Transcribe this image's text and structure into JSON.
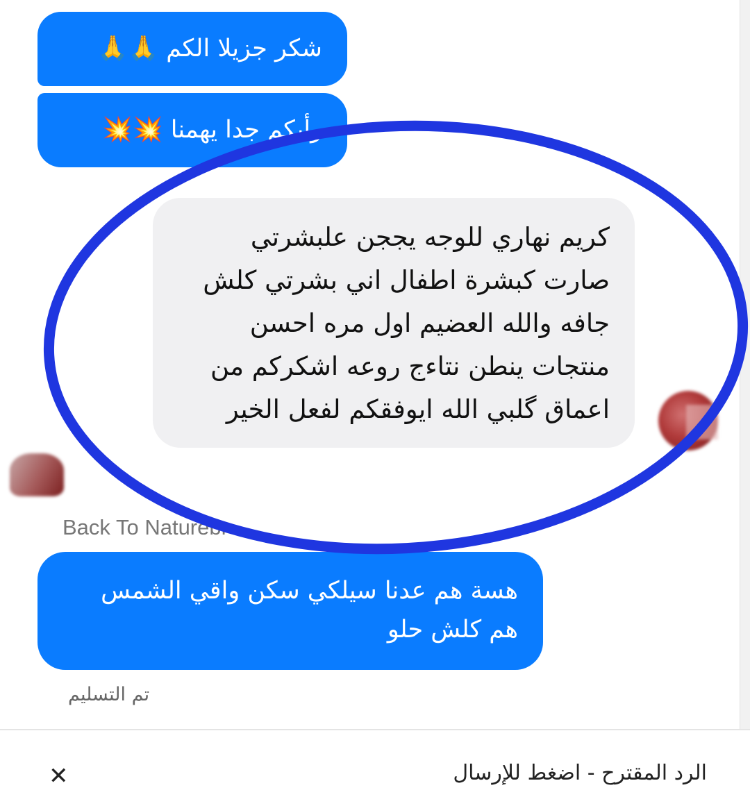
{
  "conversation": {
    "messages": [
      {
        "text": "شكر جزيلا الكم 🙏🙏"
      },
      {
        "text": "رأيكم جدا يهمنا 💥💥"
      },
      {
        "text": "كريم نهاري للوجه يججن علبشرتي\nصارت كبشرة اطفال اني بشرتي كلش\nجافه والله العضيم اول مره احسن\nمنتجات ينطن نتاءج روعه اشكركم من\nاعماق گلبي الله ايوفقكم لفعل الخير"
      },
      {
        "text": "هسة هم عدنا سيلكي سكن واقي الشمس\nهم كلش حلو"
      }
    ],
    "sender_name": "Back To Naturebr",
    "delivered_status": "تم التسليم"
  },
  "suggested_reply": {
    "label": "الرد المقترح - اضغط للإرسال",
    "close_symbol": "✕"
  },
  "colors": {
    "sent_bubble": "#0a7cff",
    "received_bubble": "#f0f0f2",
    "highlight_ring": "#1f36e0"
  }
}
